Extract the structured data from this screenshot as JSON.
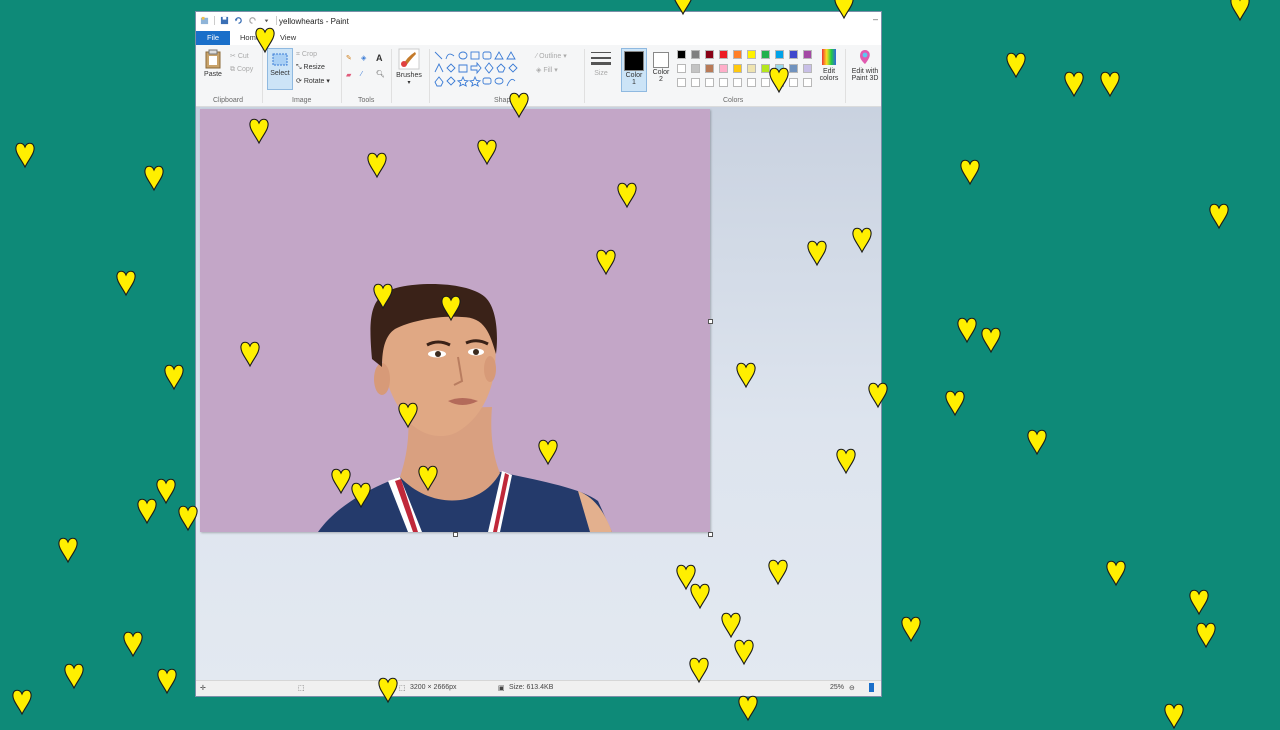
{
  "window": {
    "title": "yellowhearts - Paint"
  },
  "tabs": [
    {
      "label": "File"
    },
    {
      "label": "Home"
    },
    {
      "label": "View"
    }
  ],
  "ribbon": {
    "clipboard": {
      "paste": "Paste",
      "cut": "Cut",
      "copy": "Copy",
      "group": "Clipboard"
    },
    "image": {
      "select": "Select",
      "crop": "Crop",
      "resize": "Resize",
      "rotate": "Rotate",
      "group": "Image"
    },
    "tools": {
      "group": "Tools"
    },
    "brushes": {
      "label": "Brushes"
    },
    "shapes": {
      "group": "Shapes",
      "outline": "Outline",
      "fill": "Fill"
    },
    "size": {
      "label": "Size"
    },
    "color1": {
      "label": "Color",
      "num": "1"
    },
    "color2": {
      "label": "Color",
      "num": "2"
    },
    "colors": {
      "group": "Colors"
    },
    "edit_colors": {
      "line1": "Edit",
      "line2": "colors"
    },
    "paint3d": {
      "line1": "Edit with",
      "line2": "Paint 3D"
    }
  },
  "palette": {
    "row1": [
      "#000000",
      "#7f7f7f",
      "#880015",
      "#ed1c24",
      "#ff7f27",
      "#fff200",
      "#22b14c",
      "#00a2e8",
      "#3f48cc",
      "#a349a4"
    ],
    "row2": [
      "#ffffff",
      "#c3c3c3",
      "#b97a57",
      "#ffaec9",
      "#ffc90e",
      "#efe4b0",
      "#b5e61d",
      "#99d9ea",
      "#7092be",
      "#c8bfe7"
    ]
  },
  "colors": {
    "background": "#0e8a78",
    "photo_background": "#c3a6c7",
    "heart_fill": "#ffef00",
    "accent": "#1a6fc9"
  },
  "status": {
    "dimensions": "3200 × 2666px",
    "size": "Size: 613.4KB",
    "zoom": "25%"
  }
}
